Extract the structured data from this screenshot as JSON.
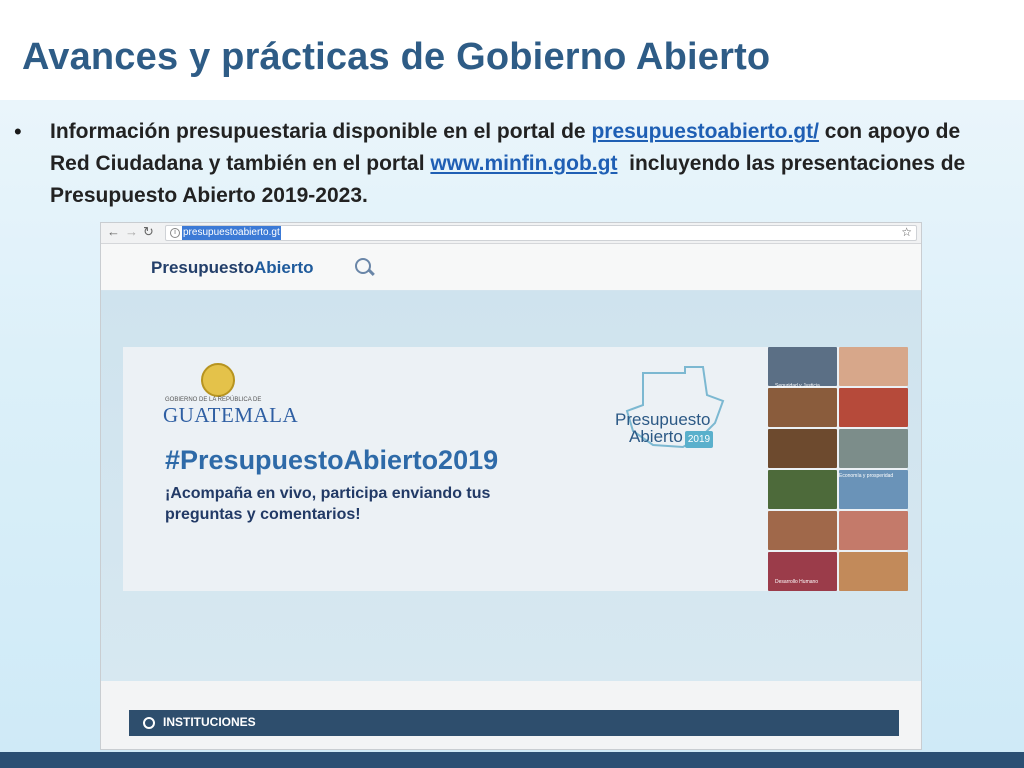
{
  "slide": {
    "title": "Avances y prácticas de Gobierno Abierto",
    "bullet": {
      "text_before": "Información presupuestaria disponible en el portal de ",
      "link1": "presupuestoabierto.gt/",
      "text_middle": " con apoyo de Red Ciudadana y también en el portal ",
      "link2": "www.minfin.gob.gt",
      "text_after": "  incluyendo las presentaciones de Presupuesto Abierto 2019-2023."
    }
  },
  "browser": {
    "url": "presupuestoabierto.gt",
    "site_logo_part1": "Presupuesto",
    "site_logo_part2": "Abierto",
    "banner": {
      "org_small": "GOBIERNO DE LA REPÚBLICA DE",
      "org_name": "GUATEMALA",
      "hashtag": "#PresupuestoAbierto2019",
      "tagline": "¡Acompaña en vivo, participa enviando tus preguntas y comentarios!",
      "logo_line1": "Presupuesto",
      "logo_line2": "Abierto",
      "logo_year": "2019",
      "captions": [
        "Seguridad y Justicia",
        "Economía y prosperidad",
        "Desarrollo Humano"
      ]
    },
    "section_label": "INSTITUCIONES"
  },
  "colors": {
    "title": "#2e5c86",
    "link": "#1f5fb4",
    "footer": "#2b4f73",
    "instituciones_bar": "#2e4e6d"
  }
}
